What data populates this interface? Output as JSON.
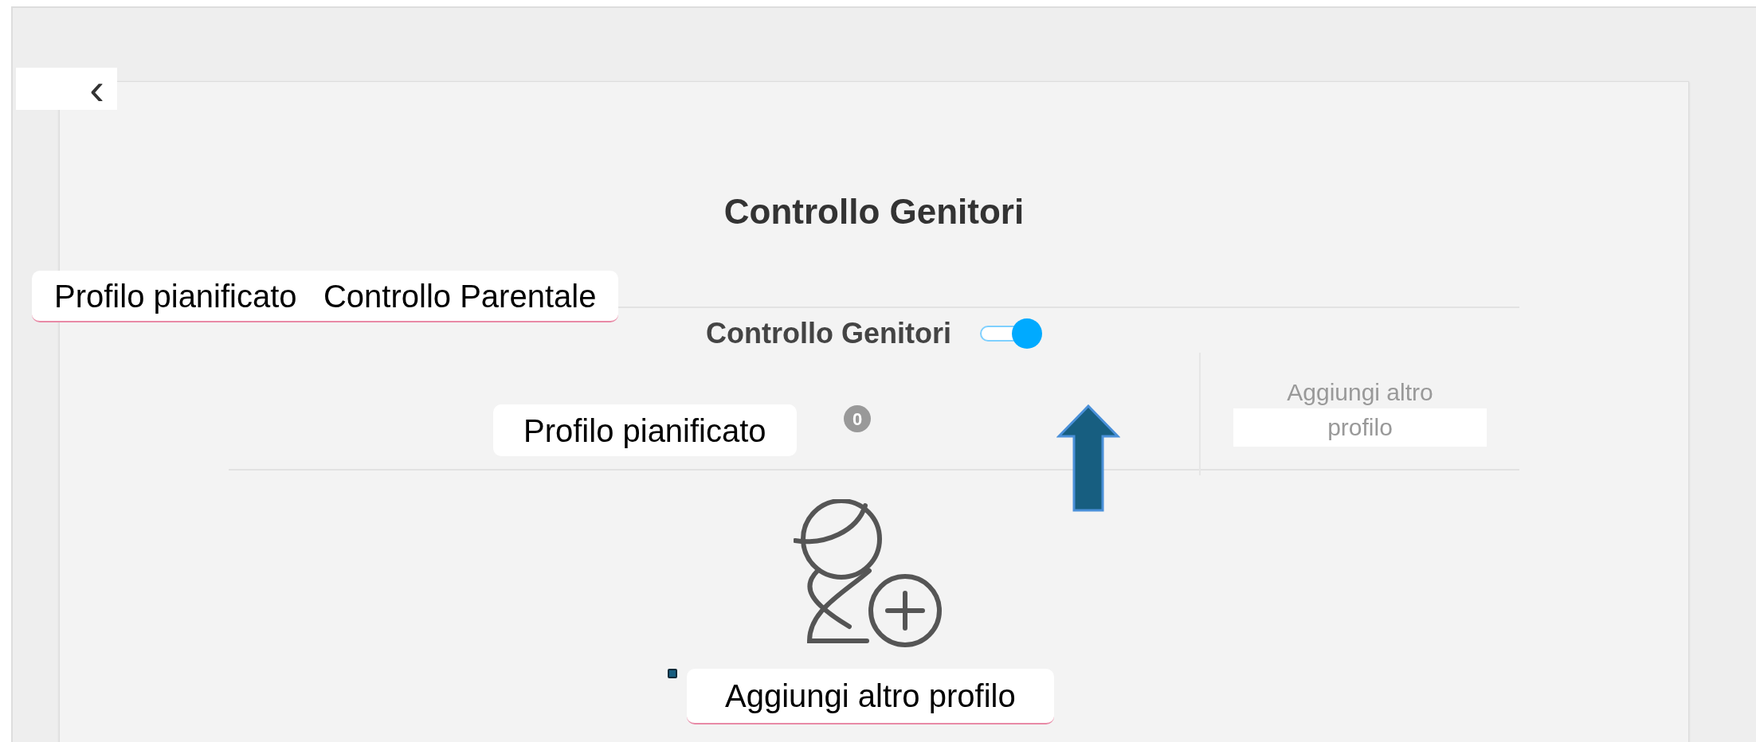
{
  "back_button": {
    "icon": "‹"
  },
  "page_title": "Controllo Genitori",
  "parental_toggle": {
    "label": "Controllo Genitori",
    "on": true
  },
  "scheduled_profile": {
    "count": "0"
  },
  "add_profile_tab": {
    "lines": [
      "Aggiungi altro",
      "profilo"
    ]
  },
  "annotations": [
    {
      "kind": "label",
      "text": "Profilo pianificato   Controllo Parentale"
    },
    {
      "kind": "label",
      "text": "Profilo pianificato"
    },
    {
      "kind": "arrow"
    },
    {
      "kind": "label",
      "text": "Aggiungi altro profilo"
    }
  ]
}
